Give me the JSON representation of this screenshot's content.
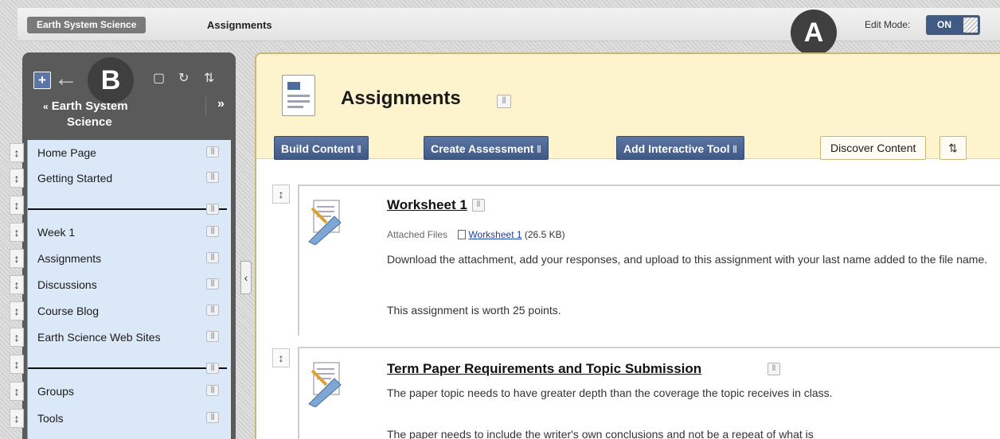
{
  "breadcrumb": {
    "course": "Earth System Science",
    "page": "Assignments"
  },
  "edit_mode": {
    "label": "Edit Mode:",
    "state": "ON"
  },
  "callouts": {
    "a": "A",
    "b": "B"
  },
  "course_menu": {
    "title_line1": "Earth System",
    "title_line2": "Science",
    "collapse_chevron": "«",
    "expand_chevron": "»",
    "toolbar_plus": "+",
    "items": [
      {
        "label": "Home Page",
        "type": "link"
      },
      {
        "label": "Getting Started",
        "type": "link"
      },
      {
        "label": "",
        "type": "divider"
      },
      {
        "label": "Week 1",
        "type": "link"
      },
      {
        "label": "Assignments",
        "type": "link"
      },
      {
        "label": "Discussions",
        "type": "link"
      },
      {
        "label": "Course Blog",
        "type": "link"
      },
      {
        "label": "Earth Science Web Sites",
        "type": "link"
      },
      {
        "label": "",
        "type": "divider"
      },
      {
        "label": "Groups",
        "type": "link"
      },
      {
        "label": "Tools",
        "type": "link"
      }
    ]
  },
  "main": {
    "title": "Assignments",
    "actions": [
      {
        "label": "Build Content"
      },
      {
        "label": "Create Assessment"
      },
      {
        "label": "Add Interactive Tool"
      }
    ],
    "discover": "Discover Content",
    "items": [
      {
        "title": "Worksheet 1",
        "attached_label": "Attached Files",
        "file_name": "Worksheet 1",
        "file_size": "(26.5 KB)",
        "text1": "Download the attachment, add your responses, and upload to this assignment with your last name added to the file name.",
        "text2": "This assignment is worth 25 points."
      },
      {
        "title": "Term Paper Requirements and Topic Submission",
        "text1": "The paper topic needs to have greater depth than the coverage the topic receives in class.",
        "text2": "The paper needs to include the writer's own conclusions and not be a repeat of what is"
      }
    ]
  },
  "colors": {
    "action_button": "#4a6594",
    "menu_background": "#dbe8f7",
    "header_background": "#fdf3cc",
    "callout": "#3f3f3f"
  }
}
